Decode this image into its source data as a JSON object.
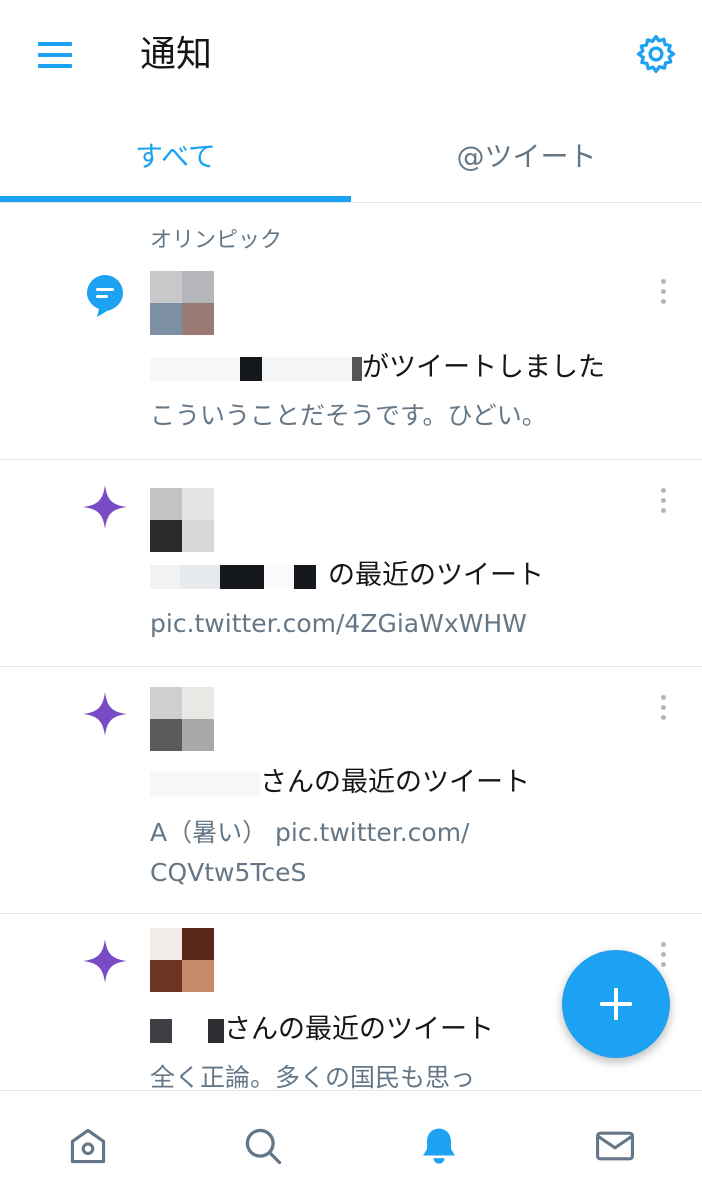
{
  "header": {
    "title": "通知",
    "menu_icon": "hamburger-menu-icon",
    "settings_icon": "gear-icon"
  },
  "tabs": [
    {
      "label": "すべて",
      "active": true
    },
    {
      "label": "@ツイート",
      "active": false
    }
  ],
  "topic_label": "オリンピック",
  "colors": {
    "accent": "#1da1f2",
    "text_primary": "#14171a",
    "text_secondary": "#657786",
    "sparkle": "#794bc4",
    "divider": "#e1e8ed"
  },
  "notifications": [
    {
      "icon": "topic-bubble-icon",
      "headline_suffix": "がツイートしました",
      "body": "こういうことだそうです。ひどい。"
    },
    {
      "icon": "sparkle-icon",
      "headline_suffix": "の最近のツイート",
      "body": "pic.twitter.com/4ZGiaWxWHW"
    },
    {
      "icon": "sparkle-icon",
      "headline_suffix": "さんの最近のツイート",
      "body_line1": "A（暑い） pic.twitter.com/",
      "body_line2": "CQVtw5TceS"
    },
    {
      "icon": "sparkle-icon",
      "headline_suffix": "さんの最近のツイート",
      "body": "全く正論。多くの国民も思っ"
    }
  ],
  "fab": {
    "icon": "compose-plus-icon"
  },
  "bottom_nav": [
    {
      "icon": "home-icon",
      "active": false
    },
    {
      "icon": "search-icon",
      "active": false
    },
    {
      "icon": "bell-icon",
      "active": true
    },
    {
      "icon": "mail-icon",
      "active": false
    }
  ]
}
